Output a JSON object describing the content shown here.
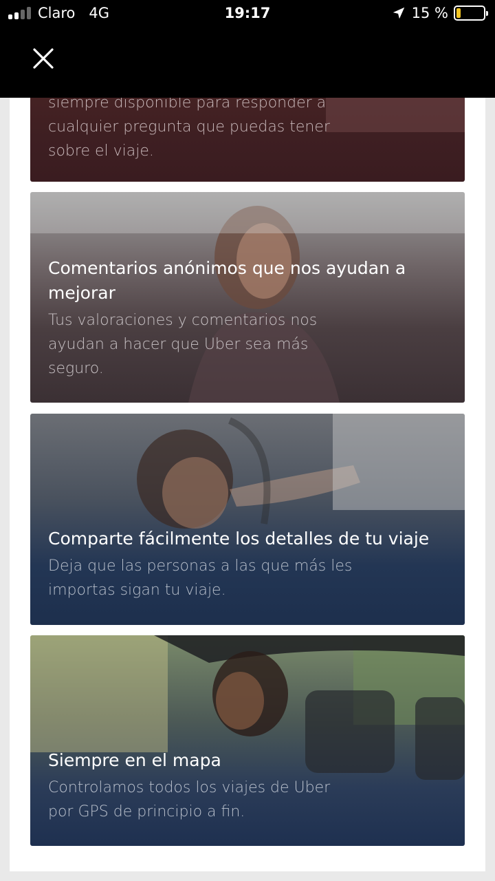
{
  "status_bar": {
    "carrier": "Claro",
    "network": "4G",
    "time": "19:17",
    "battery_percent": "15 %",
    "battery_level": 0.15,
    "battery_color": "#f3c623"
  },
  "nav": {
    "close_icon": "close-icon"
  },
  "cards": [
    {
      "title": "",
      "body": "siempre disponible para responder a cualquier pregunta que puedas tener sobre el viaje."
    },
    {
      "title": "Comentarios anónimos que nos ayudan a mejorar",
      "body": "Tus valoraciones y comentarios nos ayudan a hacer que Uber sea más seguro."
    },
    {
      "title": "Comparte fácilmente los detalles de tu viaje",
      "body": "Deja que las personas a las que más les importas sigan tu viaje."
    },
    {
      "title": "Siempre en el mapa",
      "body": "Controlamos todos los viajes de Uber por GPS de principio a fin."
    }
  ]
}
